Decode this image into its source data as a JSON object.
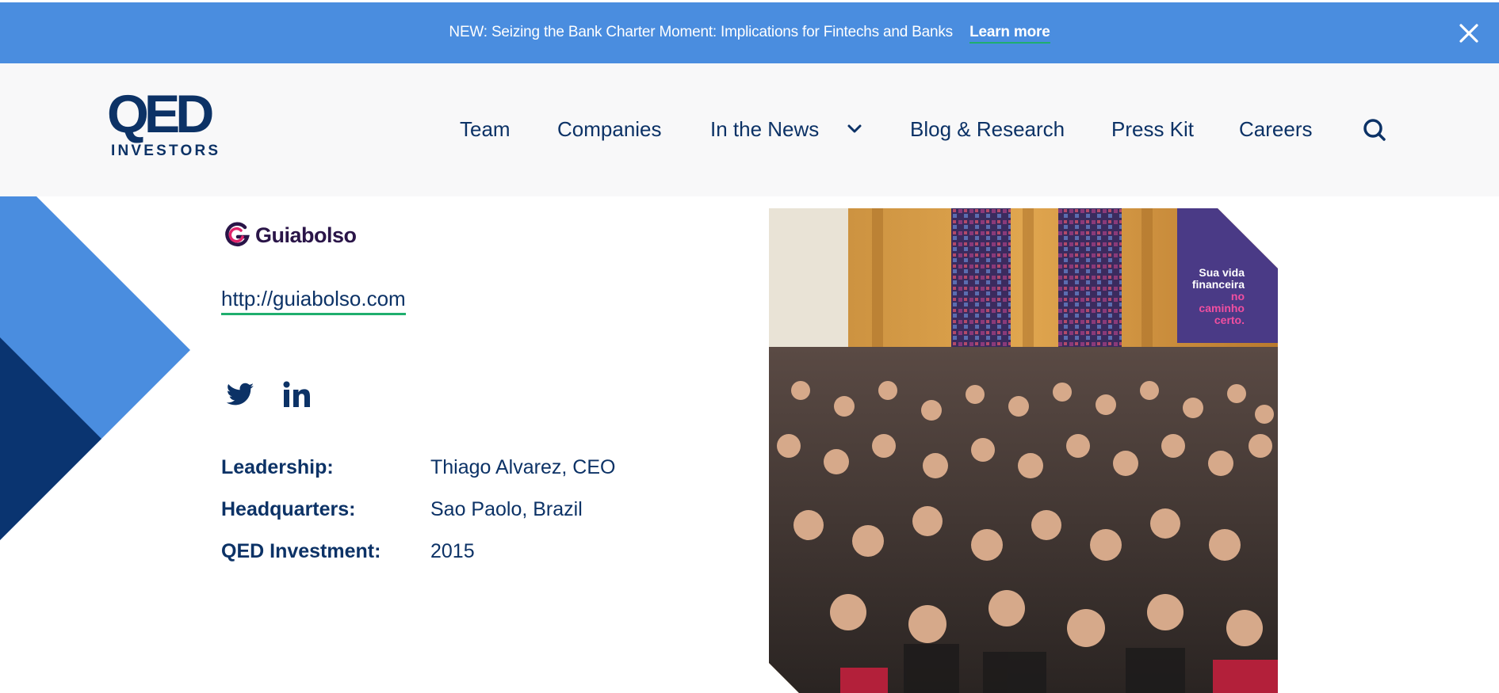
{
  "banner": {
    "message": "NEW: Seizing the Bank Charter Moment: Implications for Fintechs and Banks",
    "link_label": "Learn more",
    "close_icon": "close-icon"
  },
  "header": {
    "logo": {
      "main": "QED",
      "sub": "INVESTORS"
    },
    "nav": {
      "team": "Team",
      "companies": "Companies",
      "news": "In the News",
      "blog": "Blog & Research",
      "press": "Press Kit",
      "careers": "Careers",
      "search_icon": "search-icon"
    }
  },
  "company": {
    "name": "Guiabolso",
    "url": "http://guiabolso.com",
    "social": [
      "twitter-icon",
      "linkedin-icon"
    ],
    "details": [
      {
        "label": "Leadership:",
        "value": "Thiago Alvarez, CEO"
      },
      {
        "label": "Headquarters:",
        "value": "Sao Paolo, Brazil"
      },
      {
        "label": "QED Investment:",
        "value": "2015"
      }
    ],
    "photo_sign": {
      "line1": "Sua vida",
      "line2": "financeira",
      "line3": "no",
      "line4": "caminho",
      "line5": "certo."
    }
  },
  "colors": {
    "banner": "#4a8ddf",
    "navy": "#0c3266",
    "accent_green": "#1fae6e",
    "deco_light": "#4a8ddf",
    "deco_dark": "#0a3470"
  }
}
